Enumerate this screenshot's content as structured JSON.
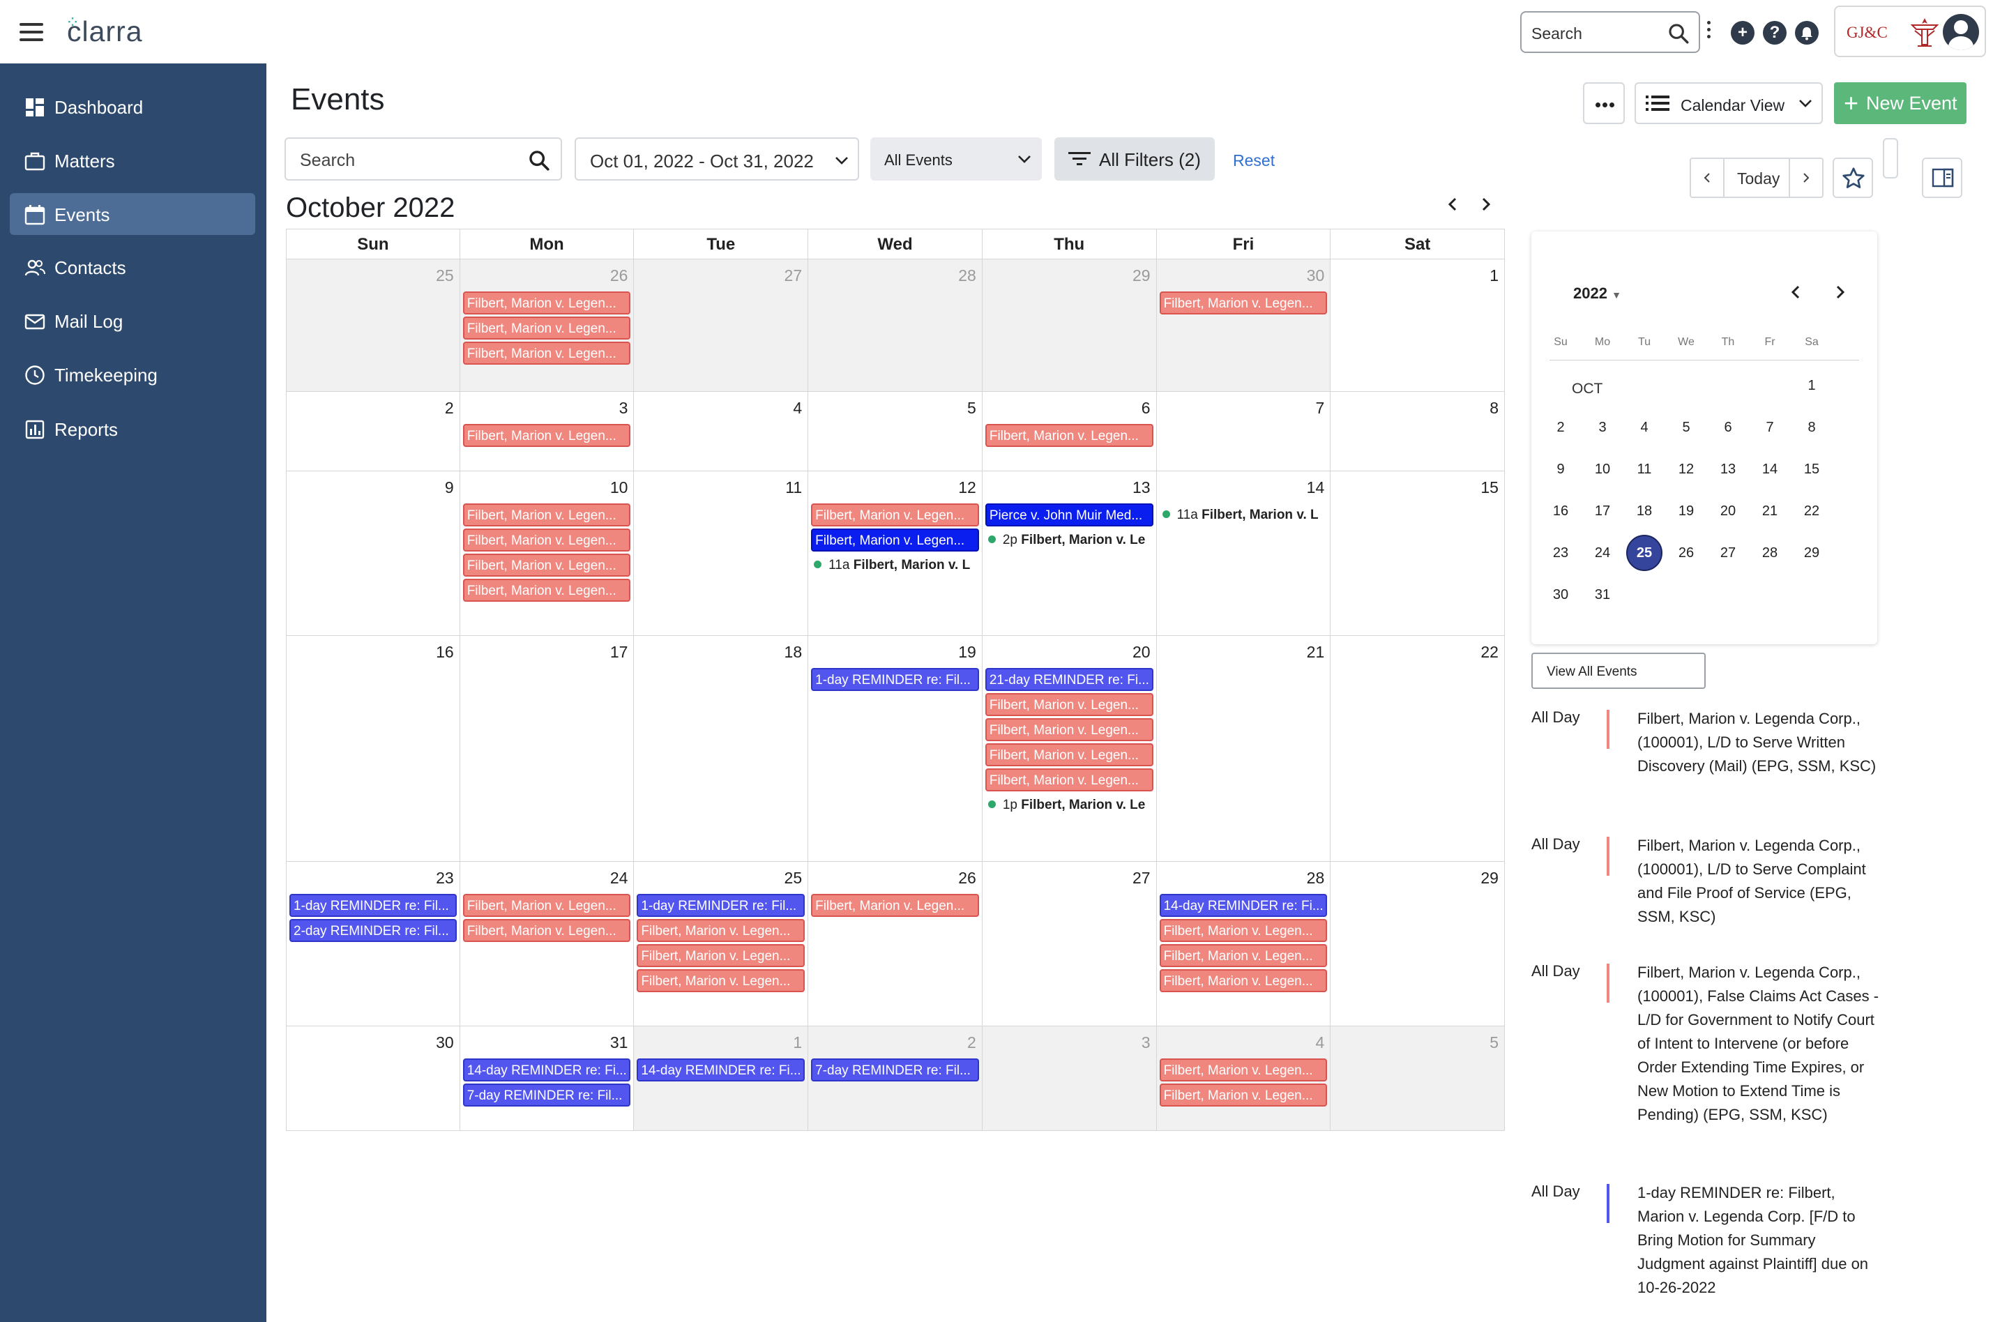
{
  "app": {
    "logo": "clarra",
    "firm_name": "GJ&C"
  },
  "topbar": {
    "search_placeholder": "Search"
  },
  "sidebar": {
    "items": [
      {
        "label": "Dashboard",
        "icon": "dashboard-icon"
      },
      {
        "label": "Matters",
        "icon": "briefcase-icon"
      },
      {
        "label": "Events",
        "icon": "calendar-icon",
        "active": true
      },
      {
        "label": "Contacts",
        "icon": "people-icon"
      },
      {
        "label": "Mail Log",
        "icon": "mail-icon"
      },
      {
        "label": "Timekeeping",
        "icon": "clock-icon"
      },
      {
        "label": "Reports",
        "icon": "report-icon"
      }
    ]
  },
  "header": {
    "title": "Events",
    "view_label": "Calendar View",
    "new_event_label": "New Event"
  },
  "filters": {
    "search_placeholder": "Search",
    "date_range": "Oct 01, 2022 - Oct 31, 2022",
    "event_type": "All Events",
    "all_filters": "All Filters (2)",
    "reset": "Reset"
  },
  "calendar": {
    "month_title": "October 2022",
    "today_label": "Today",
    "weekdays": [
      "Sun",
      "Mon",
      "Tue",
      "Wed",
      "Thu",
      "Fri",
      "Sat"
    ],
    "colors": {
      "red": "#f0877f",
      "blue": "#5356ee",
      "dark_blue": "#0a1ef0",
      "dot_green": "#2ea86a"
    },
    "weeks": [
      [
        {
          "day": "25",
          "muted": true,
          "events": []
        },
        {
          "day": "26",
          "muted": true,
          "events": [
            {
              "type": "red",
              "text": "Filbert, Marion v. Legen..."
            },
            {
              "type": "red",
              "text": "Filbert, Marion v. Legen..."
            },
            {
              "type": "red",
              "text": "Filbert, Marion v. Legen..."
            }
          ]
        },
        {
          "day": "27",
          "muted": true,
          "events": []
        },
        {
          "day": "28",
          "muted": true,
          "events": []
        },
        {
          "day": "29",
          "muted": true,
          "events": []
        },
        {
          "day": "30",
          "muted": true,
          "events": [
            {
              "type": "red",
              "text": "Filbert, Marion v. Legen..."
            }
          ]
        },
        {
          "day": "1",
          "muted": false,
          "events": []
        }
      ],
      [
        {
          "day": "2",
          "events": []
        },
        {
          "day": "3",
          "events": [
            {
              "type": "red",
              "text": "Filbert, Marion v. Legen..."
            }
          ]
        },
        {
          "day": "4",
          "events": []
        },
        {
          "day": "5",
          "events": []
        },
        {
          "day": "6",
          "events": [
            {
              "type": "red",
              "text": "Filbert, Marion v. Legen..."
            }
          ]
        },
        {
          "day": "7",
          "events": []
        },
        {
          "day": "8",
          "events": []
        }
      ],
      [
        {
          "day": "9",
          "events": []
        },
        {
          "day": "10",
          "events": [
            {
              "type": "red",
              "text": "Filbert, Marion v. Legen..."
            },
            {
              "type": "red",
              "text": "Filbert, Marion v. Legen..."
            },
            {
              "type": "red",
              "text": "Filbert, Marion v. Legen..."
            },
            {
              "type": "red",
              "text": "Filbert, Marion v. Legen..."
            }
          ]
        },
        {
          "day": "11",
          "events": []
        },
        {
          "day": "12",
          "events": [
            {
              "type": "red",
              "text": "Filbert, Marion v. Legen..."
            },
            {
              "type": "darkblue",
              "text": "Filbert, Marion v. Legen..."
            },
            {
              "type": "dot",
              "time": "11a",
              "text": "Filbert, Marion v. L"
            }
          ]
        },
        {
          "day": "13",
          "events": [
            {
              "type": "darkblue",
              "text": "Pierce v. John Muir Med..."
            },
            {
              "type": "dot",
              "time": "2p",
              "text": "Filbert, Marion v. Le"
            }
          ]
        },
        {
          "day": "14",
          "events": [
            {
              "type": "dot",
              "time": "11a",
              "text": "Filbert, Marion v. L"
            }
          ]
        },
        {
          "day": "15",
          "events": []
        }
      ],
      [
        {
          "day": "16",
          "events": []
        },
        {
          "day": "17",
          "events": []
        },
        {
          "day": "18",
          "events": []
        },
        {
          "day": "19",
          "events": [
            {
              "type": "blue",
              "text": "1-day REMINDER re: Fil..."
            }
          ]
        },
        {
          "day": "20",
          "events": [
            {
              "type": "blue",
              "text": "21-day REMINDER re: Fi..."
            },
            {
              "type": "red",
              "text": "Filbert, Marion v. Legen..."
            },
            {
              "type": "red",
              "text": "Filbert, Marion v. Legen..."
            },
            {
              "type": "red",
              "text": "Filbert, Marion v. Legen..."
            },
            {
              "type": "red",
              "text": "Filbert, Marion v. Legen..."
            },
            {
              "type": "dot",
              "time": "1p",
              "text": "Filbert, Marion v. Le"
            }
          ]
        },
        {
          "day": "21",
          "events": []
        },
        {
          "day": "22",
          "events": []
        }
      ],
      [
        {
          "day": "23",
          "events": [
            {
              "type": "blue",
              "text": "1-day REMINDER re: Fil..."
            },
            {
              "type": "blue",
              "text": "2-day REMINDER re: Fil..."
            }
          ]
        },
        {
          "day": "24",
          "events": [
            {
              "type": "red",
              "text": "Filbert, Marion v. Legen..."
            },
            {
              "type": "red",
              "text": "Filbert, Marion v. Legen..."
            }
          ]
        },
        {
          "day": "25",
          "events": [
            {
              "type": "blue",
              "text": "1-day REMINDER re: Fil..."
            },
            {
              "type": "red",
              "text": "Filbert, Marion v. Legen..."
            },
            {
              "type": "red",
              "text": "Filbert, Marion v. Legen..."
            },
            {
              "type": "red",
              "text": "Filbert, Marion v. Legen..."
            }
          ]
        },
        {
          "day": "26",
          "events": [
            {
              "type": "red",
              "text": "Filbert, Marion v. Legen..."
            }
          ]
        },
        {
          "day": "27",
          "events": []
        },
        {
          "day": "28",
          "events": [
            {
              "type": "blue",
              "text": "14-day REMINDER re: Fi..."
            },
            {
              "type": "red",
              "text": "Filbert, Marion v. Legen..."
            },
            {
              "type": "red",
              "text": "Filbert, Marion v. Legen..."
            },
            {
              "type": "red",
              "text": "Filbert, Marion v. Legen..."
            }
          ]
        },
        {
          "day": "29",
          "events": []
        }
      ],
      [
        {
          "day": "30",
          "events": []
        },
        {
          "day": "31",
          "events": [
            {
              "type": "blue",
              "text": "14-day REMINDER re: Fi..."
            },
            {
              "type": "blue",
              "text": "7-day REMINDER re: Fil..."
            }
          ]
        },
        {
          "day": "1",
          "muted": true,
          "events": [
            {
              "type": "blue",
              "text": "14-day REMINDER re: Fi..."
            }
          ]
        },
        {
          "day": "2",
          "muted": true,
          "events": [
            {
              "type": "blue",
              "text": "7-day REMINDER re: Fil..."
            }
          ]
        },
        {
          "day": "3",
          "muted": true,
          "events": []
        },
        {
          "day": "4",
          "muted": true,
          "events": [
            {
              "type": "red",
              "text": "Filbert, Marion v. Legen..."
            },
            {
              "type": "red",
              "text": "Filbert, Marion v. Legen..."
            }
          ]
        },
        {
          "day": "5",
          "muted": true,
          "events": []
        }
      ]
    ]
  },
  "mini_calendar": {
    "year": "2022",
    "weekdays": [
      "Su",
      "Mo",
      "Tu",
      "We",
      "Th",
      "Fr",
      "Sa"
    ],
    "month_label": "OCT",
    "selected_day": "25",
    "weeks": [
      [
        "",
        "",
        "",
        "",
        "",
        "",
        "1"
      ],
      [
        "2",
        "3",
        "4",
        "5",
        "6",
        "7",
        "8"
      ],
      [
        "9",
        "10",
        "11",
        "12",
        "13",
        "14",
        "15"
      ],
      [
        "16",
        "17",
        "18",
        "19",
        "20",
        "21",
        "22"
      ],
      [
        "23",
        "24",
        "25",
        "26",
        "27",
        "28",
        "29"
      ],
      [
        "30",
        "31",
        "",
        "",
        "",
        "",
        ""
      ]
    ],
    "view_all_label": "View All Events"
  },
  "agenda": [
    {
      "when": "All Day",
      "color": "#f0877f",
      "text": "Filbert, Marion v. Legenda Corp., (100001), L/D to Serve Written Discovery (Mail) (EPG, SSM, KSC)"
    },
    {
      "when": "All Day",
      "color": "#f0877f",
      "text": "Filbert, Marion v. Legenda Corp., (100001), L/D to Serve Complaint and File Proof of Service (EPG, SSM, KSC)"
    },
    {
      "when": "All Day",
      "color": "#f0877f",
      "text": "Filbert, Marion v. Legenda Corp., (100001), False Claims Act Cases - L/D for Government to Notify Court of Intent to Intervene (or before Order Extending Time Expires, or New Motion to Extend Time is Pending) (EPG, SSM, KSC)"
    },
    {
      "when": "All Day",
      "color": "#5356ee",
      "text": "1-day REMINDER re: Filbert, Marion v. Legenda Corp. [F/D to Bring Motion for Summary Judgment against Plaintiff] due on 10-26-2022"
    }
  ]
}
